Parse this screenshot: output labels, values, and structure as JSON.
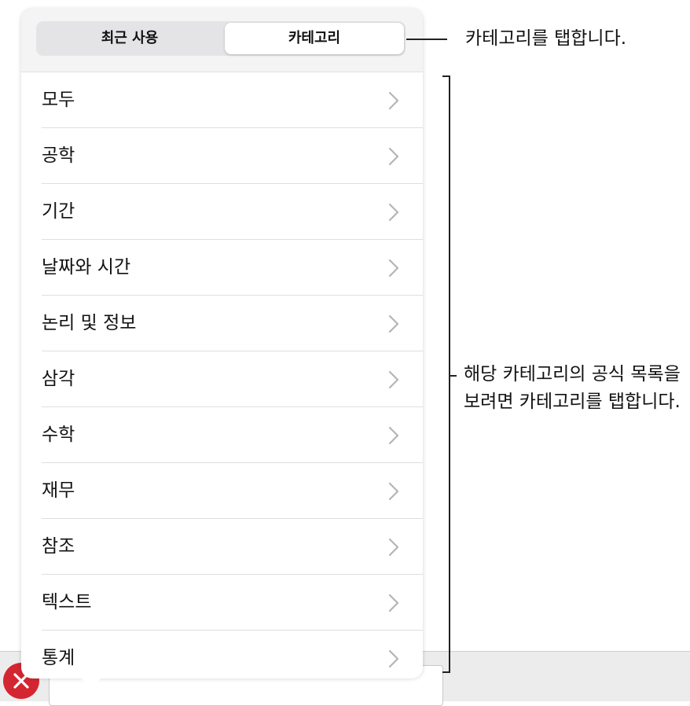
{
  "segmented": {
    "recent_label": "최근 사용",
    "category_label": "카테고리",
    "selected": "카테고리"
  },
  "categories": [
    {
      "label": "모두"
    },
    {
      "label": "공학"
    },
    {
      "label": "기간"
    },
    {
      "label": "날짜와 시간"
    },
    {
      "label": "논리 및 정보"
    },
    {
      "label": "삼각"
    },
    {
      "label": "수학"
    },
    {
      "label": "재무"
    },
    {
      "label": "참조"
    },
    {
      "label": "텍스트"
    },
    {
      "label": "통계"
    }
  ],
  "callouts": {
    "tab_hint": "카테고리를 탭합니다.",
    "list_hint_line1": "해당 카테고리의 공식 목록을",
    "list_hint_line2": "보려면 카테고리를 탭합니다."
  },
  "icons": {
    "row_chevron": "chevron-right-icon",
    "close": "close-icon"
  },
  "colors": {
    "close_button": "#d42630",
    "chevron": "#b5b5b8",
    "popover_bg": "#f4f4f5"
  }
}
